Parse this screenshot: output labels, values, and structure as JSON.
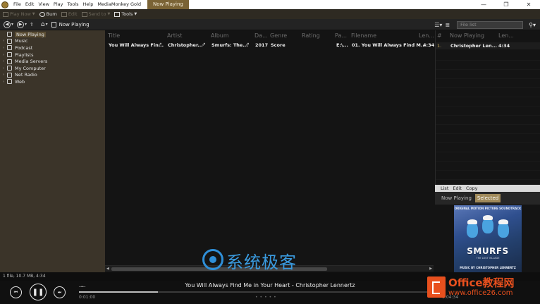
{
  "menu": {
    "items": [
      "File",
      "Edit",
      "View",
      "Play",
      "Tools",
      "Help",
      "MediaMonkey Gold"
    ],
    "active_tab": "Now Playing"
  },
  "toolbar": {
    "play_now": "Play Now",
    "burn": "Burn",
    "edit": "Edit",
    "send_to": "Send to",
    "tools": "Tools"
  },
  "nav": {
    "breadcrumb": "Now Playing",
    "filter_placeholder": "File list"
  },
  "tree": {
    "items": [
      {
        "label": "Now Playing",
        "icon": "now-playing-icon"
      },
      {
        "label": "Music",
        "icon": "music-icon"
      },
      {
        "label": "Podcast",
        "icon": "podcast-icon"
      },
      {
        "label": "Playlists",
        "icon": "playlist-icon"
      },
      {
        "label": "Media Servers",
        "icon": "server-icon"
      },
      {
        "label": "My Computer",
        "icon": "computer-icon"
      },
      {
        "label": "Net Radio",
        "icon": "radio-icon"
      },
      {
        "label": "Web",
        "icon": "web-icon"
      }
    ]
  },
  "tracklist": {
    "columns": [
      "Title",
      "Artist",
      "Album",
      "Da...",
      "Genre",
      "Rating",
      "Pa...",
      "Filename",
      "Len..."
    ],
    "row": {
      "title": "You Will Always Fin...",
      "artist": "Christopher...",
      "album": "Smurfs: The...",
      "date": "2017",
      "genre": "Score",
      "path": "E:\\...",
      "filename": "01. You Will Always Find M...",
      "length": "4:34"
    }
  },
  "nowplaying_pane": {
    "columns": [
      "#",
      "Now Playing",
      "Len..."
    ],
    "row": {
      "num": "1.",
      "artist": "Christopher Len...",
      "length": "4:34"
    }
  },
  "info_panel": {
    "menu": [
      "List",
      "Edit",
      "Copy"
    ],
    "tabs": [
      "Now Playing",
      "Selected"
    ],
    "album_art": {
      "top": "ORIGINAL MOTION PICTURE SOUNDTRACK",
      "title": "SMURFS",
      "subtitle": "THE LOST VILLAGE",
      "bottom": "MUSIC BY CHRISTOPHER LENNERTZ"
    }
  },
  "watermark": {
    "text": "系统极客"
  },
  "status": {
    "text": "1 file, 10.7 MB, 4:34"
  },
  "player": {
    "song": "You Will Always Find Me in Your Heart - Christopher Lennertz",
    "elapsed": "0:01:00",
    "remaining": "0:04:34",
    "progress": 0.22
  },
  "office_watermark": {
    "big": "Office教程网",
    "small": "www.office26.com"
  }
}
